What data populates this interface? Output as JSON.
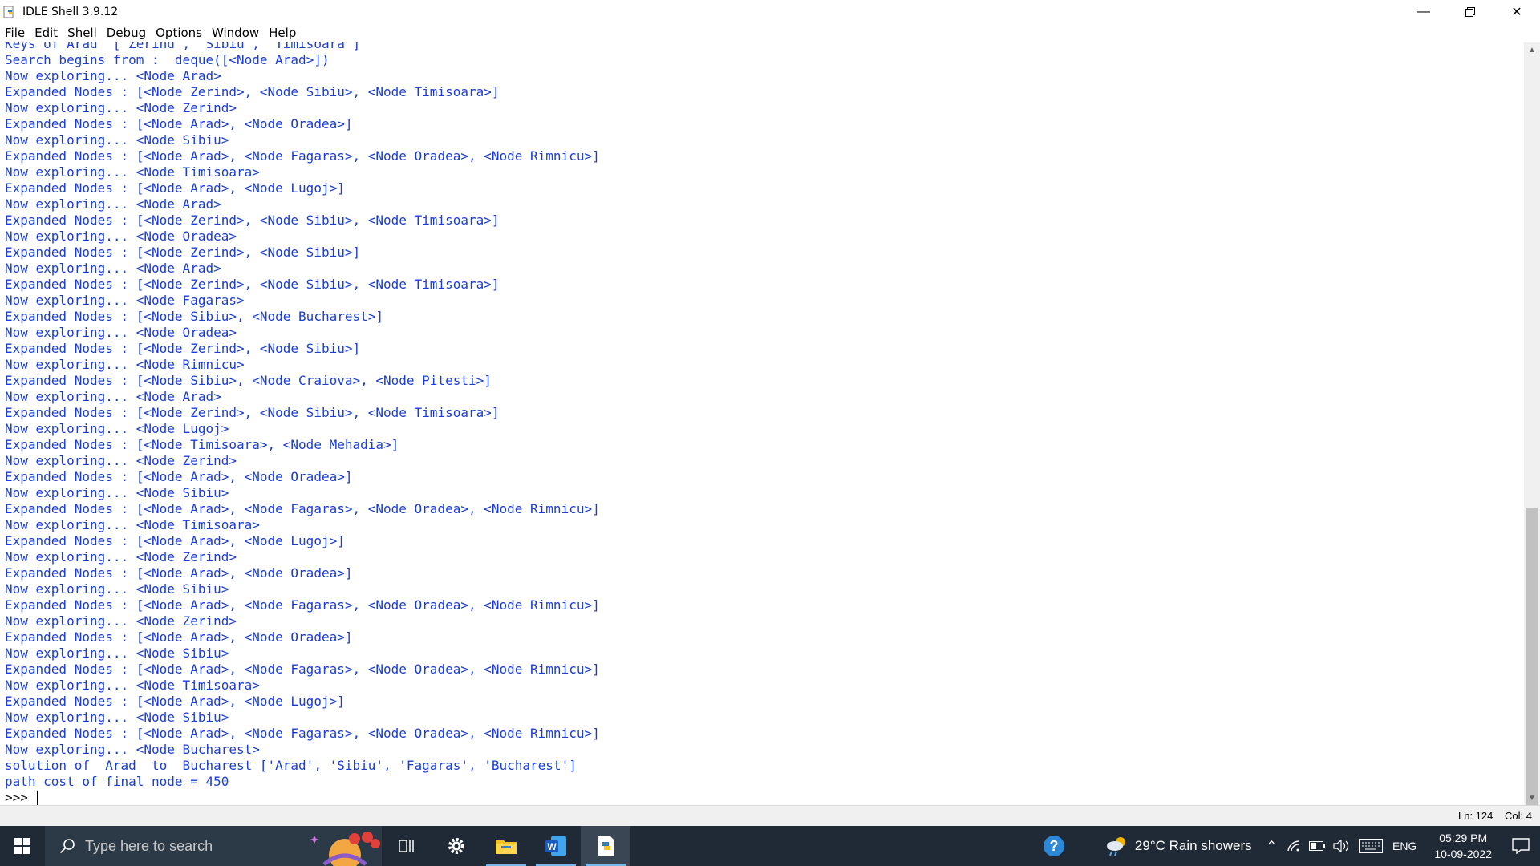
{
  "window": {
    "title": "IDLE Shell 3.9.12"
  },
  "menu": [
    "File",
    "Edit",
    "Shell",
    "Debug",
    "Options",
    "Window",
    "Help"
  ],
  "shell": {
    "partial_line": "Keys of Arad  ['Zerind', 'Sibiu', 'Timisoara']",
    "lines": [
      "Search begins from :  deque([<Node Arad>])",
      "Now exploring... <Node Arad>",
      "Expanded Nodes : [<Node Zerind>, <Node Sibiu>, <Node Timisoara>]",
      "Now exploring... <Node Zerind>",
      "Expanded Nodes : [<Node Arad>, <Node Oradea>]",
      "Now exploring... <Node Sibiu>",
      "Expanded Nodes : [<Node Arad>, <Node Fagaras>, <Node Oradea>, <Node Rimnicu>]",
      "Now exploring... <Node Timisoara>",
      "Expanded Nodes : [<Node Arad>, <Node Lugoj>]",
      "Now exploring... <Node Arad>",
      "Expanded Nodes : [<Node Zerind>, <Node Sibiu>, <Node Timisoara>]",
      "Now exploring... <Node Oradea>",
      "Expanded Nodes : [<Node Zerind>, <Node Sibiu>]",
      "Now exploring... <Node Arad>",
      "Expanded Nodes : [<Node Zerind>, <Node Sibiu>, <Node Timisoara>]",
      "Now exploring... <Node Fagaras>",
      "Expanded Nodes : [<Node Sibiu>, <Node Bucharest>]",
      "Now exploring... <Node Oradea>",
      "Expanded Nodes : [<Node Zerind>, <Node Sibiu>]",
      "Now exploring... <Node Rimnicu>",
      "Expanded Nodes : [<Node Sibiu>, <Node Craiova>, <Node Pitesti>]",
      "Now exploring... <Node Arad>",
      "Expanded Nodes : [<Node Zerind>, <Node Sibiu>, <Node Timisoara>]",
      "Now exploring... <Node Lugoj>",
      "Expanded Nodes : [<Node Timisoara>, <Node Mehadia>]",
      "Now exploring... <Node Zerind>",
      "Expanded Nodes : [<Node Arad>, <Node Oradea>]",
      "Now exploring... <Node Sibiu>",
      "Expanded Nodes : [<Node Arad>, <Node Fagaras>, <Node Oradea>, <Node Rimnicu>]",
      "Now exploring... <Node Timisoara>",
      "Expanded Nodes : [<Node Arad>, <Node Lugoj>]",
      "Now exploring... <Node Zerind>",
      "Expanded Nodes : [<Node Arad>, <Node Oradea>]",
      "Now exploring... <Node Sibiu>",
      "Expanded Nodes : [<Node Arad>, <Node Fagaras>, <Node Oradea>, <Node Rimnicu>]",
      "Now exploring... <Node Zerind>",
      "Expanded Nodes : [<Node Arad>, <Node Oradea>]",
      "Now exploring... <Node Sibiu>",
      "Expanded Nodes : [<Node Arad>, <Node Fagaras>, <Node Oradea>, <Node Rimnicu>]",
      "Now exploring... <Node Timisoara>",
      "Expanded Nodes : [<Node Arad>, <Node Lugoj>]",
      "Now exploring... <Node Sibiu>",
      "Expanded Nodes : [<Node Arad>, <Node Fagaras>, <Node Oradea>, <Node Rimnicu>]",
      "Now exploring... <Node Bucharest>",
      "solution of  Arad  to  Bucharest ['Arad', 'Sibiu', 'Fagaras', 'Bucharest']",
      "path cost of final node = 450"
    ],
    "prompt": ">>> "
  },
  "status": {
    "line": "Ln: 124",
    "col": "Col: 4"
  },
  "taskbar": {
    "search_placeholder": "Type here to search",
    "weather": "29°C  Rain showers",
    "language": "ENG",
    "time": "05:29 PM",
    "date": "10-09-2022"
  },
  "colors": {
    "shell_output": "#1a3dd8",
    "taskbar": "#1f2a36"
  }
}
